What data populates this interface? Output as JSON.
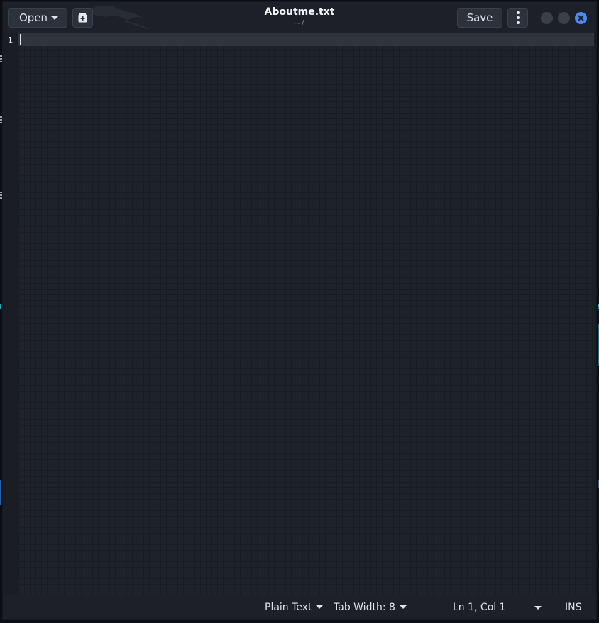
{
  "window": {
    "title": "Aboutme.txt",
    "subtitle": "~/"
  },
  "header": {
    "open_label": "Open",
    "save_label": "Save",
    "icons": {
      "open_dropdown": "chevron-down-icon",
      "new_document": "new-document-icon",
      "menu": "vertical-ellipsis-icon",
      "minimize": "minimize-icon",
      "maximize": "maximize-icon",
      "close": "close-icon"
    }
  },
  "editor": {
    "line_numbers": [
      "1"
    ],
    "content": ""
  },
  "statusbar": {
    "language": "Plain Text",
    "tab_width": "Tab Width: 8",
    "cursor_position": "Ln 1, Col 1",
    "mode": "INS"
  },
  "colors": {
    "accent_close": "#4c89f0",
    "background": "#1e222a",
    "text": "#dfe3ea"
  }
}
